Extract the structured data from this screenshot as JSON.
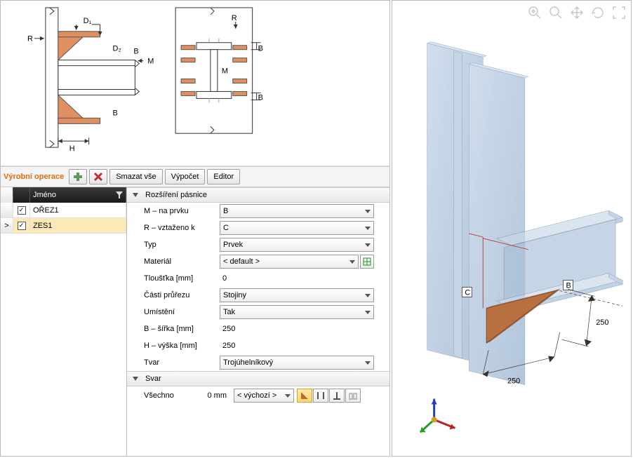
{
  "section_title": "Výrobní operace",
  "toolbar": {
    "add_tooltip": "+",
    "del_tooltip": "×",
    "clear_label": "Smazat vše",
    "calc_label": "Výpočet",
    "editor_label": "Editor"
  },
  "ops_header": {
    "name_label": "Jméno"
  },
  "ops": [
    {
      "checked": true,
      "name": "OŘEZ1",
      "selected": false,
      "indicator": ""
    },
    {
      "checked": true,
      "name": "ZES1",
      "selected": true,
      "indicator": ">"
    }
  ],
  "groups": {
    "g1": {
      "title": "Rozšíření pásnice"
    },
    "g2": {
      "title": "Svar"
    }
  },
  "props": {
    "m_label": "M – na prvku",
    "m_value": "B",
    "r_label": "R – vztaženo k",
    "r_value": "C",
    "typ_label": "Typ",
    "typ_value": "Prvek",
    "mat_label": "Materiál",
    "mat_value": "< default >",
    "th_label": "Tloušťka [mm]",
    "th_value": "0",
    "cp_label": "Části průřezu",
    "cp_value": "Stojiny",
    "um_label": "Umístění",
    "um_value": "Tak",
    "b_label": "B – šířka [mm]",
    "b_value": "250",
    "h_label": "H – výška [mm]",
    "h_value": "250",
    "tv_label": "Tvar",
    "tv_value": "Trojúhelníkový"
  },
  "weld": {
    "all_label": "Všechno",
    "all_value": "0 mm",
    "select_value": "< výchozí >"
  },
  "diagram": {
    "labels": {
      "R": "R",
      "M": "M",
      "B": "B",
      "H": "H",
      "D1": "D₁",
      "D2": "D₂"
    }
  },
  "viewport": {
    "labelC": "C",
    "labelB": "B",
    "dim1": "250",
    "dim2": "250"
  }
}
